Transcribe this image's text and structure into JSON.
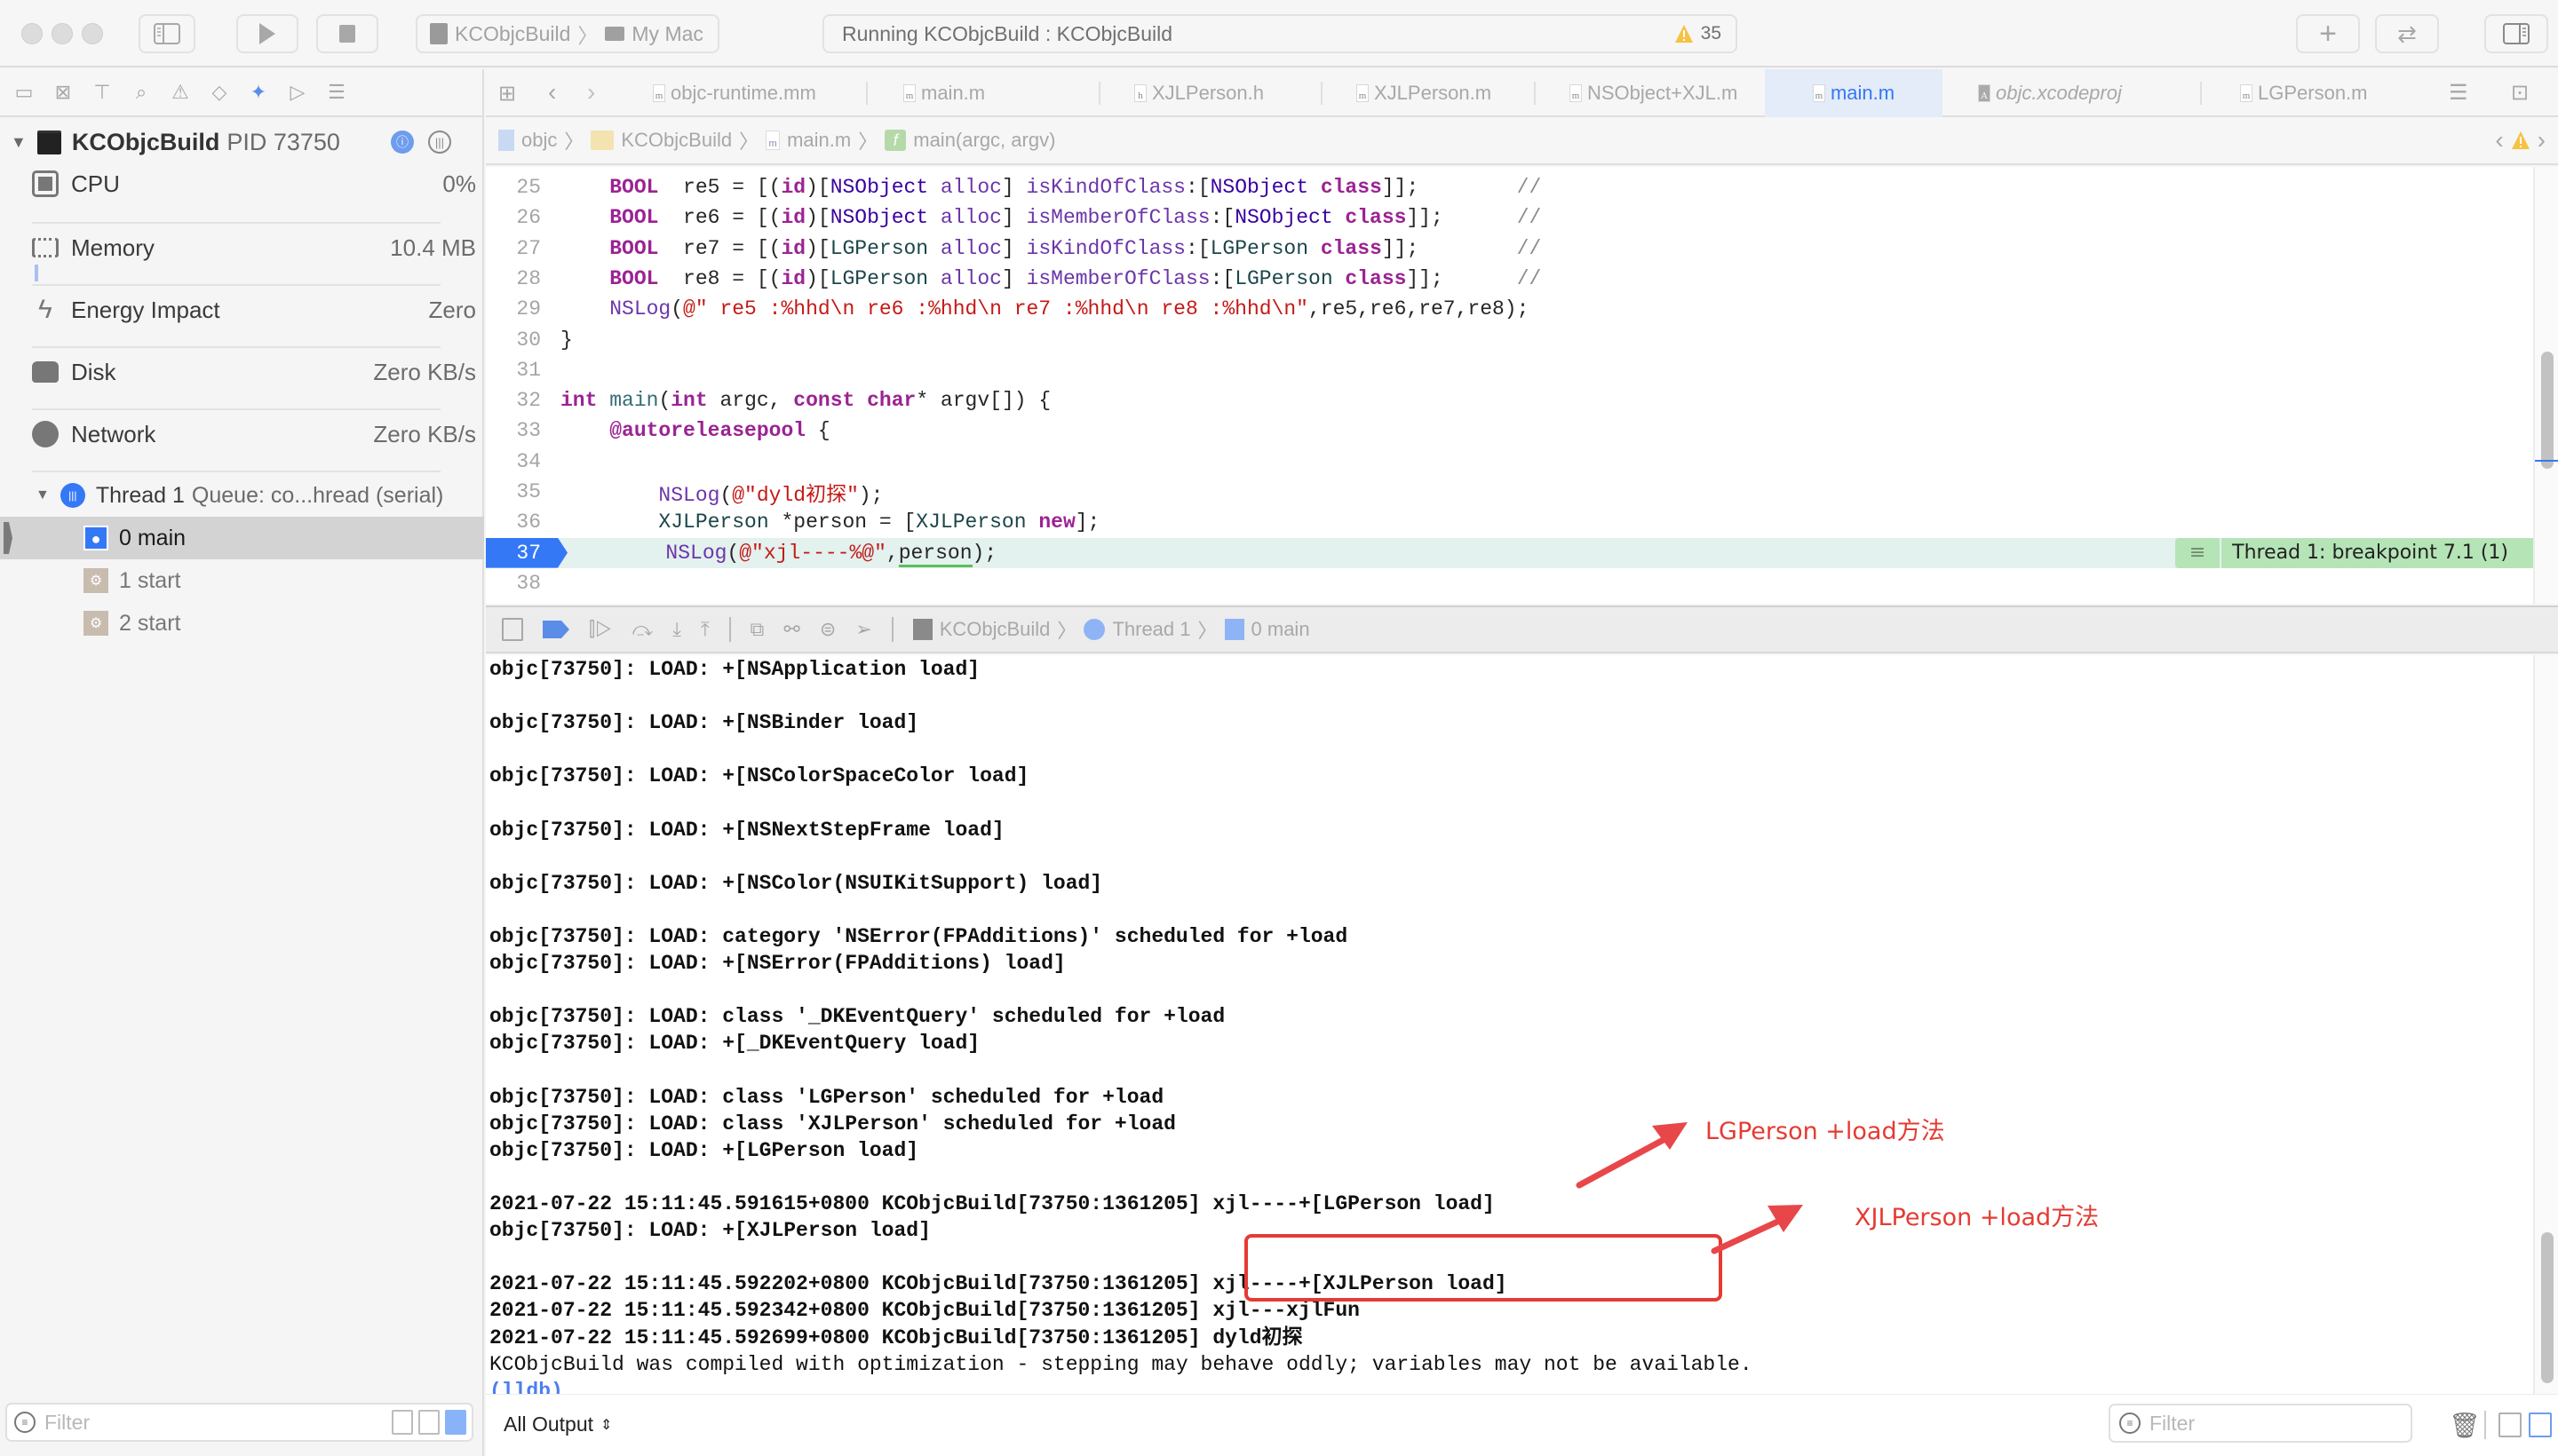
{
  "toolbar": {
    "scheme_target": "KCObjcBuild",
    "scheme_device": "My Mac",
    "status_text": "Running KCObjcBuild : KCObjcBuild",
    "warning_count": "35",
    "icons": [
      "sidebar-toggle-icon",
      "run-icon",
      "stop-icon",
      "add-icon",
      "swap-icon",
      "inspector-toggle-icon"
    ]
  },
  "navigator": {
    "icons": [
      "folder-icon",
      "source-control-icon",
      "hierarchy-icon",
      "search-icon",
      "warning-icon",
      "test-icon",
      "debug-icon",
      "breakpoint-icon",
      "report-icon"
    ],
    "process": {
      "name": "KCObjcBuild",
      "pid_label": "PID 73750"
    },
    "gauges": [
      {
        "label": "CPU",
        "value": "0%",
        "icon": "cpu-icon"
      },
      {
        "label": "Memory",
        "value": "10.4 MB",
        "icon": "memory-icon"
      },
      {
        "label": "Energy Impact",
        "value": "Zero",
        "icon": "energy-icon"
      },
      {
        "label": "Disk",
        "value": "Zero KB/s",
        "icon": "disk-icon"
      },
      {
        "label": "Network",
        "value": "Zero KB/s",
        "icon": "network-icon"
      }
    ],
    "thread": {
      "name": "Thread 1",
      "queue": "Queue: co...hread (serial)"
    },
    "frames": [
      {
        "label": "0 main",
        "selected": true
      },
      {
        "label": "1 start",
        "selected": false
      },
      {
        "label": "2 start",
        "selected": false
      }
    ],
    "filter_placeholder": "Filter"
  },
  "tabs": [
    {
      "label": "objc-runtime.mm",
      "type": "m",
      "active": false
    },
    {
      "label": "main.m",
      "type": "m",
      "active": false
    },
    {
      "label": "XJLPerson.h",
      "type": "h",
      "active": false
    },
    {
      "label": "XJLPerson.m",
      "type": "m",
      "active": false
    },
    {
      "label": "NSObject+XJL.m",
      "type": "m",
      "active": false
    },
    {
      "label": "main.m",
      "type": "m",
      "active": true
    },
    {
      "label": "objc.xcodeproj",
      "type": "proj",
      "active": false
    },
    {
      "label": "LGPerson.m",
      "type": "m",
      "active": false
    }
  ],
  "jumpbar": {
    "items": [
      "objc",
      "KCObjcBuild",
      "main.m",
      "main(argc, argv)"
    ]
  },
  "editor": {
    "lines": [
      {
        "n": "25",
        "html_key": "l25"
      },
      {
        "n": "26",
        "html_key": "l26"
      },
      {
        "n": "27",
        "html_key": "l27"
      },
      {
        "n": "28",
        "html_key": "l28"
      },
      {
        "n": "29",
        "html_key": "l29"
      },
      {
        "n": "30",
        "html_key": "l30"
      },
      {
        "n": "31",
        "html_key": "l31"
      },
      {
        "n": "32",
        "html_key": "l32"
      },
      {
        "n": "33",
        "html_key": "l33"
      },
      {
        "n": "34",
        "html_key": "l34"
      },
      {
        "n": "35",
        "html_key": "l35"
      },
      {
        "n": "36",
        "html_key": "l36"
      },
      {
        "n": "37",
        "html_key": "l37"
      },
      {
        "n": "38",
        "html_key": "l38"
      }
    ],
    "tokens": {
      "l25": [
        [
          "kw",
          "BOOL"
        ],
        [
          "",
          "  re5 = [("
        ],
        [
          "kw",
          "id"
        ],
        [
          "",
          ")["
        ],
        [
          "tp",
          "NSObject"
        ],
        [
          "",
          ""
        ],
        [
          "fn",
          " alloc"
        ],
        [
          "",
          "] "
        ],
        [
          "fn",
          "isKindOfClass"
        ],
        [
          "",
          ":["
        ],
        [
          "tp",
          "NSObject"
        ],
        [
          "",
          ""
        ],
        [
          "kw",
          " class"
        ],
        [
          "",
          "]];"
        ],
        [
          "cmt",
          "        //"
        ]
      ],
      "l26": [
        [
          "kw",
          "BOOL"
        ],
        [
          "",
          "  re6 = [("
        ],
        [
          "kw",
          "id"
        ],
        [
          "",
          ")["
        ],
        [
          "tp",
          "NSObject"
        ],
        [
          "fn",
          " alloc"
        ],
        [
          "",
          "] "
        ],
        [
          "fn",
          "isMemberOfClass"
        ],
        [
          "",
          ":["
        ],
        [
          "tp",
          "NSObject"
        ],
        [
          "kw",
          " class"
        ],
        [
          "",
          "]];"
        ],
        [
          "cmt",
          "      //"
        ]
      ],
      "l27": [
        [
          "kw",
          "BOOL"
        ],
        [
          "",
          "  re7 = [("
        ],
        [
          "kw",
          "id"
        ],
        [
          "",
          ")["
        ],
        [
          "cls",
          "LGPerson"
        ],
        [
          "fn",
          " alloc"
        ],
        [
          "",
          "] "
        ],
        [
          "fn",
          "isKindOfClass"
        ],
        [
          "",
          ":["
        ],
        [
          "cls",
          "LGPerson"
        ],
        [
          "kw",
          " class"
        ],
        [
          "",
          "]];"
        ],
        [
          "cmt",
          "        //"
        ]
      ],
      "l28": [
        [
          "kw",
          "BOOL"
        ],
        [
          "",
          "  re8 = [("
        ],
        [
          "kw",
          "id"
        ],
        [
          "",
          ")["
        ],
        [
          "cls",
          "LGPerson"
        ],
        [
          "fn",
          " alloc"
        ],
        [
          "",
          "] "
        ],
        [
          "fn",
          "isMemberOfClass"
        ],
        [
          "",
          ":["
        ],
        [
          "cls",
          "LGPerson"
        ],
        [
          "kw",
          " class"
        ],
        [
          "",
          "]];"
        ],
        [
          "cmt",
          "      //"
        ]
      ],
      "l29": [
        [
          "fn",
          "NSLog"
        ],
        [
          "",
          "("
        ],
        [
          "str",
          "@\" re5 :%hhd\\n re6 :%hhd\\n re7 :%hhd\\n re8 :%hhd\\n\""
        ],
        [
          "",
          ",re5,re6,re7,re8);"
        ]
      ],
      "l30": [
        [
          "",
          "}"
        ]
      ],
      "l31": [],
      "l32": [
        [
          "kw",
          "int"
        ],
        [
          "",
          ""
        ],
        [
          "mcall",
          " main"
        ],
        [
          "",
          "("
        ],
        [
          "kw",
          "int"
        ],
        [
          "",
          " argc, "
        ],
        [
          "kw",
          "const"
        ],
        [
          "",
          ""
        ],
        [
          "kw",
          " char"
        ],
        [
          "",
          "",
          " "
        ],
        [
          "",
          ""
        ],
        [
          "",
          "* argv[]) {"
        ]
      ],
      "l33": [
        [
          "kw",
          "@autoreleasepool"
        ],
        [
          "",
          " {"
        ]
      ],
      "l34": [],
      "l35": [
        [
          "fn",
          "NSLog"
        ],
        [
          "",
          "("
        ],
        [
          "str",
          "@\"dyld初探\""
        ],
        [
          "",
          ");"
        ]
      ],
      "l36": [
        [
          "cls",
          "XJLPerson"
        ],
        [
          "",
          " *person = ["
        ],
        [
          "cls",
          "XJLPerson"
        ],
        [
          "kw",
          " new"
        ],
        [
          "",
          "];"
        ]
      ],
      "l37": [
        [
          "fn",
          "NSLog"
        ],
        [
          "",
          "("
        ],
        [
          "str",
          "@\"xjl----%@\""
        ],
        [
          "",
          ",person);"
        ]
      ],
      "l38": []
    },
    "indent": {
      "l25": 1,
      "l26": 1,
      "l27": 1,
      "l28": 1,
      "l29": 1,
      "l30": 0,
      "l31": 0,
      "l32": 0,
      "l33": 1,
      "l34": 0,
      "l35": 2,
      "l36": 2,
      "l37": 2,
      "l38": 0
    },
    "current_line": "37",
    "breakpoint_label": "Thread 1: breakpoint 7.1 (1)"
  },
  "debugbar": {
    "crumbs": [
      "KCObjcBuild",
      "Thread 1",
      "0 main"
    ]
  },
  "console": {
    "lines": [
      "objc[73750]: LOAD: +[NSApplication load]",
      "",
      "objc[73750]: LOAD: +[NSBinder load]",
      "",
      "objc[73750]: LOAD: +[NSColorSpaceColor load]",
      "",
      "objc[73750]: LOAD: +[NSNextStepFrame load]",
      "",
      "objc[73750]: LOAD: +[NSColor(NSUIKitSupport) load]",
      "",
      "objc[73750]: LOAD: category 'NSError(FPAdditions)' scheduled for +load",
      "objc[73750]: LOAD: +[NSError(FPAdditions) load]",
      "",
      "objc[73750]: LOAD: class '_DKEventQuery' scheduled for +load",
      "objc[73750]: LOAD: +[_DKEventQuery load]",
      "",
      "objc[73750]: LOAD: class 'LGPerson' scheduled for +load",
      "objc[73750]: LOAD: class 'XJLPerson' scheduled for +load",
      "objc[73750]: LOAD: +[LGPerson load]",
      "",
      "2021-07-22 15:11:45.591615+0800 KCObjcBuild[73750:1361205] xjl----+[LGPerson load]",
      "objc[73750]: LOAD: +[XJLPerson load]",
      "",
      "2021-07-22 15:11:45.592202+0800 KCObjcBuild[73750:1361205] xjl----+[XJLPerson load]",
      "2021-07-22 15:11:45.592342+0800 KCObjcBuild[73750:1361205] xjl---xjlFun",
      "2021-07-22 15:11:45.592699+0800 KCObjcBuild[73750:1361205] dyld初探",
      "KCObjcBuild was compiled with optimization - stepping may behave oddly; variables may not be available."
    ],
    "prompt": "(lldb)",
    "output_selector": "All Output",
    "filter_placeholder": "Filter"
  },
  "annotations": {
    "lgperson_note": "LGPerson +load方法",
    "xjlperson_note": "XJLPerson +load方法",
    "color": "#e53b33"
  },
  "colors": {
    "accent": "#3478f6",
    "breakpoint_bg": "#b5e4b7",
    "current_line_bg": "#e3f1ef",
    "warning": "#f5c242"
  }
}
